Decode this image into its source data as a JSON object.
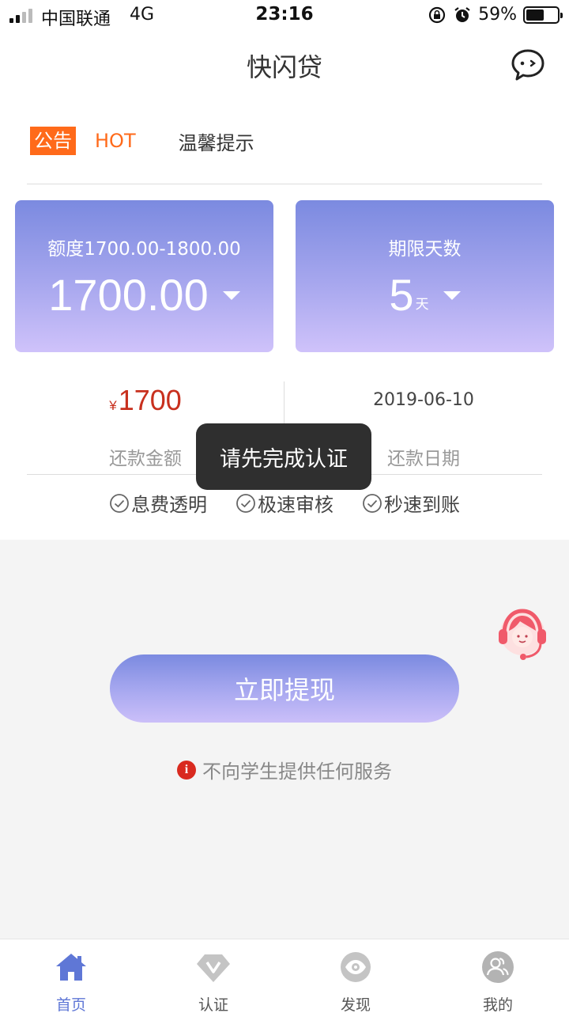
{
  "status_bar": {
    "carrier": "中国联通",
    "network": "4G",
    "time": "23:16",
    "battery": "59%",
    "battery_level": 0.59
  },
  "header": {
    "title": "快闪贷",
    "chat_icon": "chat-bubble-icon"
  },
  "notice": {
    "badge": "公告",
    "hot": "HOT",
    "text": "温馨提示"
  },
  "amount_card": {
    "label": "额度1700.00-1800.00",
    "value": "1700.00"
  },
  "days_card": {
    "label": "期限天数",
    "value": "5",
    "unit": "天"
  },
  "repayment": {
    "currency": "¥",
    "amount": "1700",
    "amount_caption": "还款金额",
    "date": "2019-06-10",
    "date_caption": "还款日期"
  },
  "features": [
    {
      "label": "息费透明"
    },
    {
      "label": "极速审核"
    },
    {
      "label": "秒速到账"
    }
  ],
  "withdraw_button": "立即提现",
  "disclaimer": {
    "icon": "i",
    "text": "不向学生提供任何服务"
  },
  "toast": "请先完成认证",
  "tabs": [
    {
      "label": "首页",
      "icon": "home-icon",
      "active": true
    },
    {
      "label": "认证",
      "icon": "diamond-icon"
    },
    {
      "label": "发现",
      "icon": "eye-icon"
    },
    {
      "label": "我的",
      "icon": "user-icon"
    }
  ],
  "colors": {
    "accent": "#5f77d6",
    "hot": "#ff6a1a",
    "amount_red": "#c8301e"
  }
}
